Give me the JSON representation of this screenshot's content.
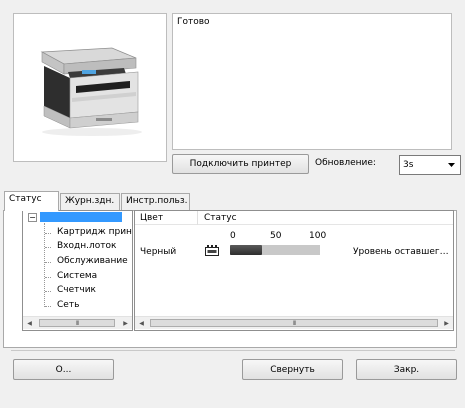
{
  "status_text": "Готово",
  "connect_button": "Подключить принтер",
  "refresh": {
    "label": "Обновление:",
    "value": "3s"
  },
  "tabs": [
    {
      "label": "Статус",
      "active": true
    },
    {
      "label": "Журн.здн.",
      "active": false
    },
    {
      "label": "Инстр.польз.",
      "active": false
    }
  ],
  "tree": {
    "collapse_glyph": "−",
    "items": [
      "Картридж прин",
      "Входн.лоток",
      "Обслуживание",
      "Система",
      "Счетчик",
      "Сеть"
    ]
  },
  "table": {
    "headers": [
      "Цвет",
      "Статус"
    ],
    "scale": [
      "0",
      "50",
      "100"
    ],
    "rows": [
      {
        "color": "Черный",
        "level_percent": 35,
        "status": "Уровень оставшег…"
      }
    ]
  },
  "scroll_thumb_grip": "III",
  "buttons": {
    "about": "О...",
    "minimize": "Свернуть",
    "close": "Закр."
  },
  "colors": {
    "selection": "#3399ff",
    "toner_fill": "#3c3c3c",
    "toner_track": "#c8c8c8"
  }
}
